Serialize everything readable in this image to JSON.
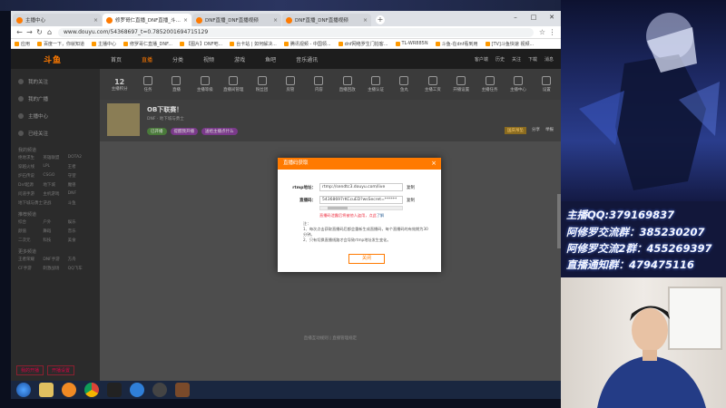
{
  "browser": {
    "tabs": [
      {
        "label": "主播中心",
        "active": false
      },
      {
        "label": "修罗哥仁直播_DNF直播_斗鱼直播",
        "active": true
      },
      {
        "label": "DNF直播_DNF直播视频",
        "active": false
      },
      {
        "label": "DNF直播_DNF直播视频",
        "active": false
      }
    ],
    "url": "www.douyu.com/54368697_t=0.7852001694715129",
    "bookmarks": [
      "应用",
      "百度一下，你就知道",
      "主播中心",
      "修罗哥仁直播_DNF...",
      "【图片】DNF吧...",
      "台卡站 | 如何解决...",
      "腾讯视频 - 中国领...",
      "dnf网络罗生门拍客...",
      "TL-WR885N",
      "斗鱼-在dnf看到用",
      "[TV]斗鱼快速 视频..."
    ]
  },
  "douyu": {
    "logo": "斗鱼",
    "nav": [
      "首页",
      "直播",
      "分类",
      "视频",
      "游戏",
      "鱼吧",
      "音乐通讯"
    ],
    "nav_active": 1,
    "right_nav": [
      "客户端",
      "历史",
      "关注",
      "下载",
      "消息"
    ],
    "sidebar": {
      "items": [
        "我的关注",
        "我的广播",
        "主播中心",
        "已经关注"
      ],
      "section1": "我的频道",
      "grid1": [
        "绝地求生",
        "英雄联盟",
        "DOTA2",
        "穿越火线",
        "LPL",
        "王者",
        "炉石传说",
        "CSGO",
        "守望",
        "Dnf起源",
        "地下城",
        "魔兽",
        "问道手游",
        "主机游戏",
        "DNF",
        "地下城与勇士",
        "逆战",
        "斗鱼"
      ],
      "section2": "推荐频道",
      "grid2": [
        "综合",
        "户外",
        "娱乐",
        "颜值",
        "舞蹈",
        "音乐",
        "二次元",
        "科技",
        "美食"
      ],
      "section3": "更多频道",
      "grid3": [
        "王者荣耀",
        "DNF手游",
        "方舟",
        "CF手游",
        "刺激战场",
        "QQ飞车"
      ],
      "bottom": [
        "我的开播",
        "开播设置"
      ]
    },
    "toolbar": [
      {
        "label": "主播积分",
        "num": "12"
      },
      {
        "label": "任务"
      },
      {
        "label": "直播"
      },
      {
        "label": "主播等级"
      },
      {
        "label": "直播间管理"
      },
      {
        "label": "粉丝团"
      },
      {
        "label": "房管"
      },
      {
        "label": "内容"
      },
      {
        "label": "直播回放"
      },
      {
        "label": "主播认证"
      },
      {
        "label": "鱼丸"
      },
      {
        "label": "主播工资"
      },
      {
        "label": "开播设置"
      },
      {
        "label": "主播任务"
      },
      {
        "label": "主播中心"
      },
      {
        "label": "设置"
      }
    ],
    "room": {
      "title": "OB下联赛！",
      "meta": "DNF  ·  地下城与勇士",
      "tags": [
        "已开播",
        "提醒我开播",
        "送给主播点什么"
      ],
      "right": [
        "国庆吊坠",
        "分享",
        "举报"
      ],
      "tag_colors": [
        "#4a7a3a",
        "#7a3a8a",
        "#7a3a8a"
      ]
    },
    "footer": "直播互动规则 | 直播管理规定"
  },
  "dialog": {
    "title": "直播码获取",
    "rtmp_label": "rtmp地址：",
    "rtmp_value": "rtmp://sendtc3.douyu.com/live",
    "code_label": "直播码：",
    "code_value": "54368697rKCcuED?wsSecret=******",
    "copy_label": "复制",
    "warning": "直播码泄露后将被他人盗用，点此",
    "warning_link": "了解",
    "notes_title": "注：",
    "notes": [
      "1、每次点击获取直播码后都会重新生成直播码，每个直播码的有效期为30分钟。",
      "2、只有切换直播线路才会导致rtmp地址发生变化。"
    ],
    "button": "关闭"
  },
  "overlay": {
    "lines": [
      "主播QQ:379169837",
      "阿修罗交流群：385230207",
      "阿修罗交流2群：455269397",
      "直播通知群：479475116"
    ]
  }
}
